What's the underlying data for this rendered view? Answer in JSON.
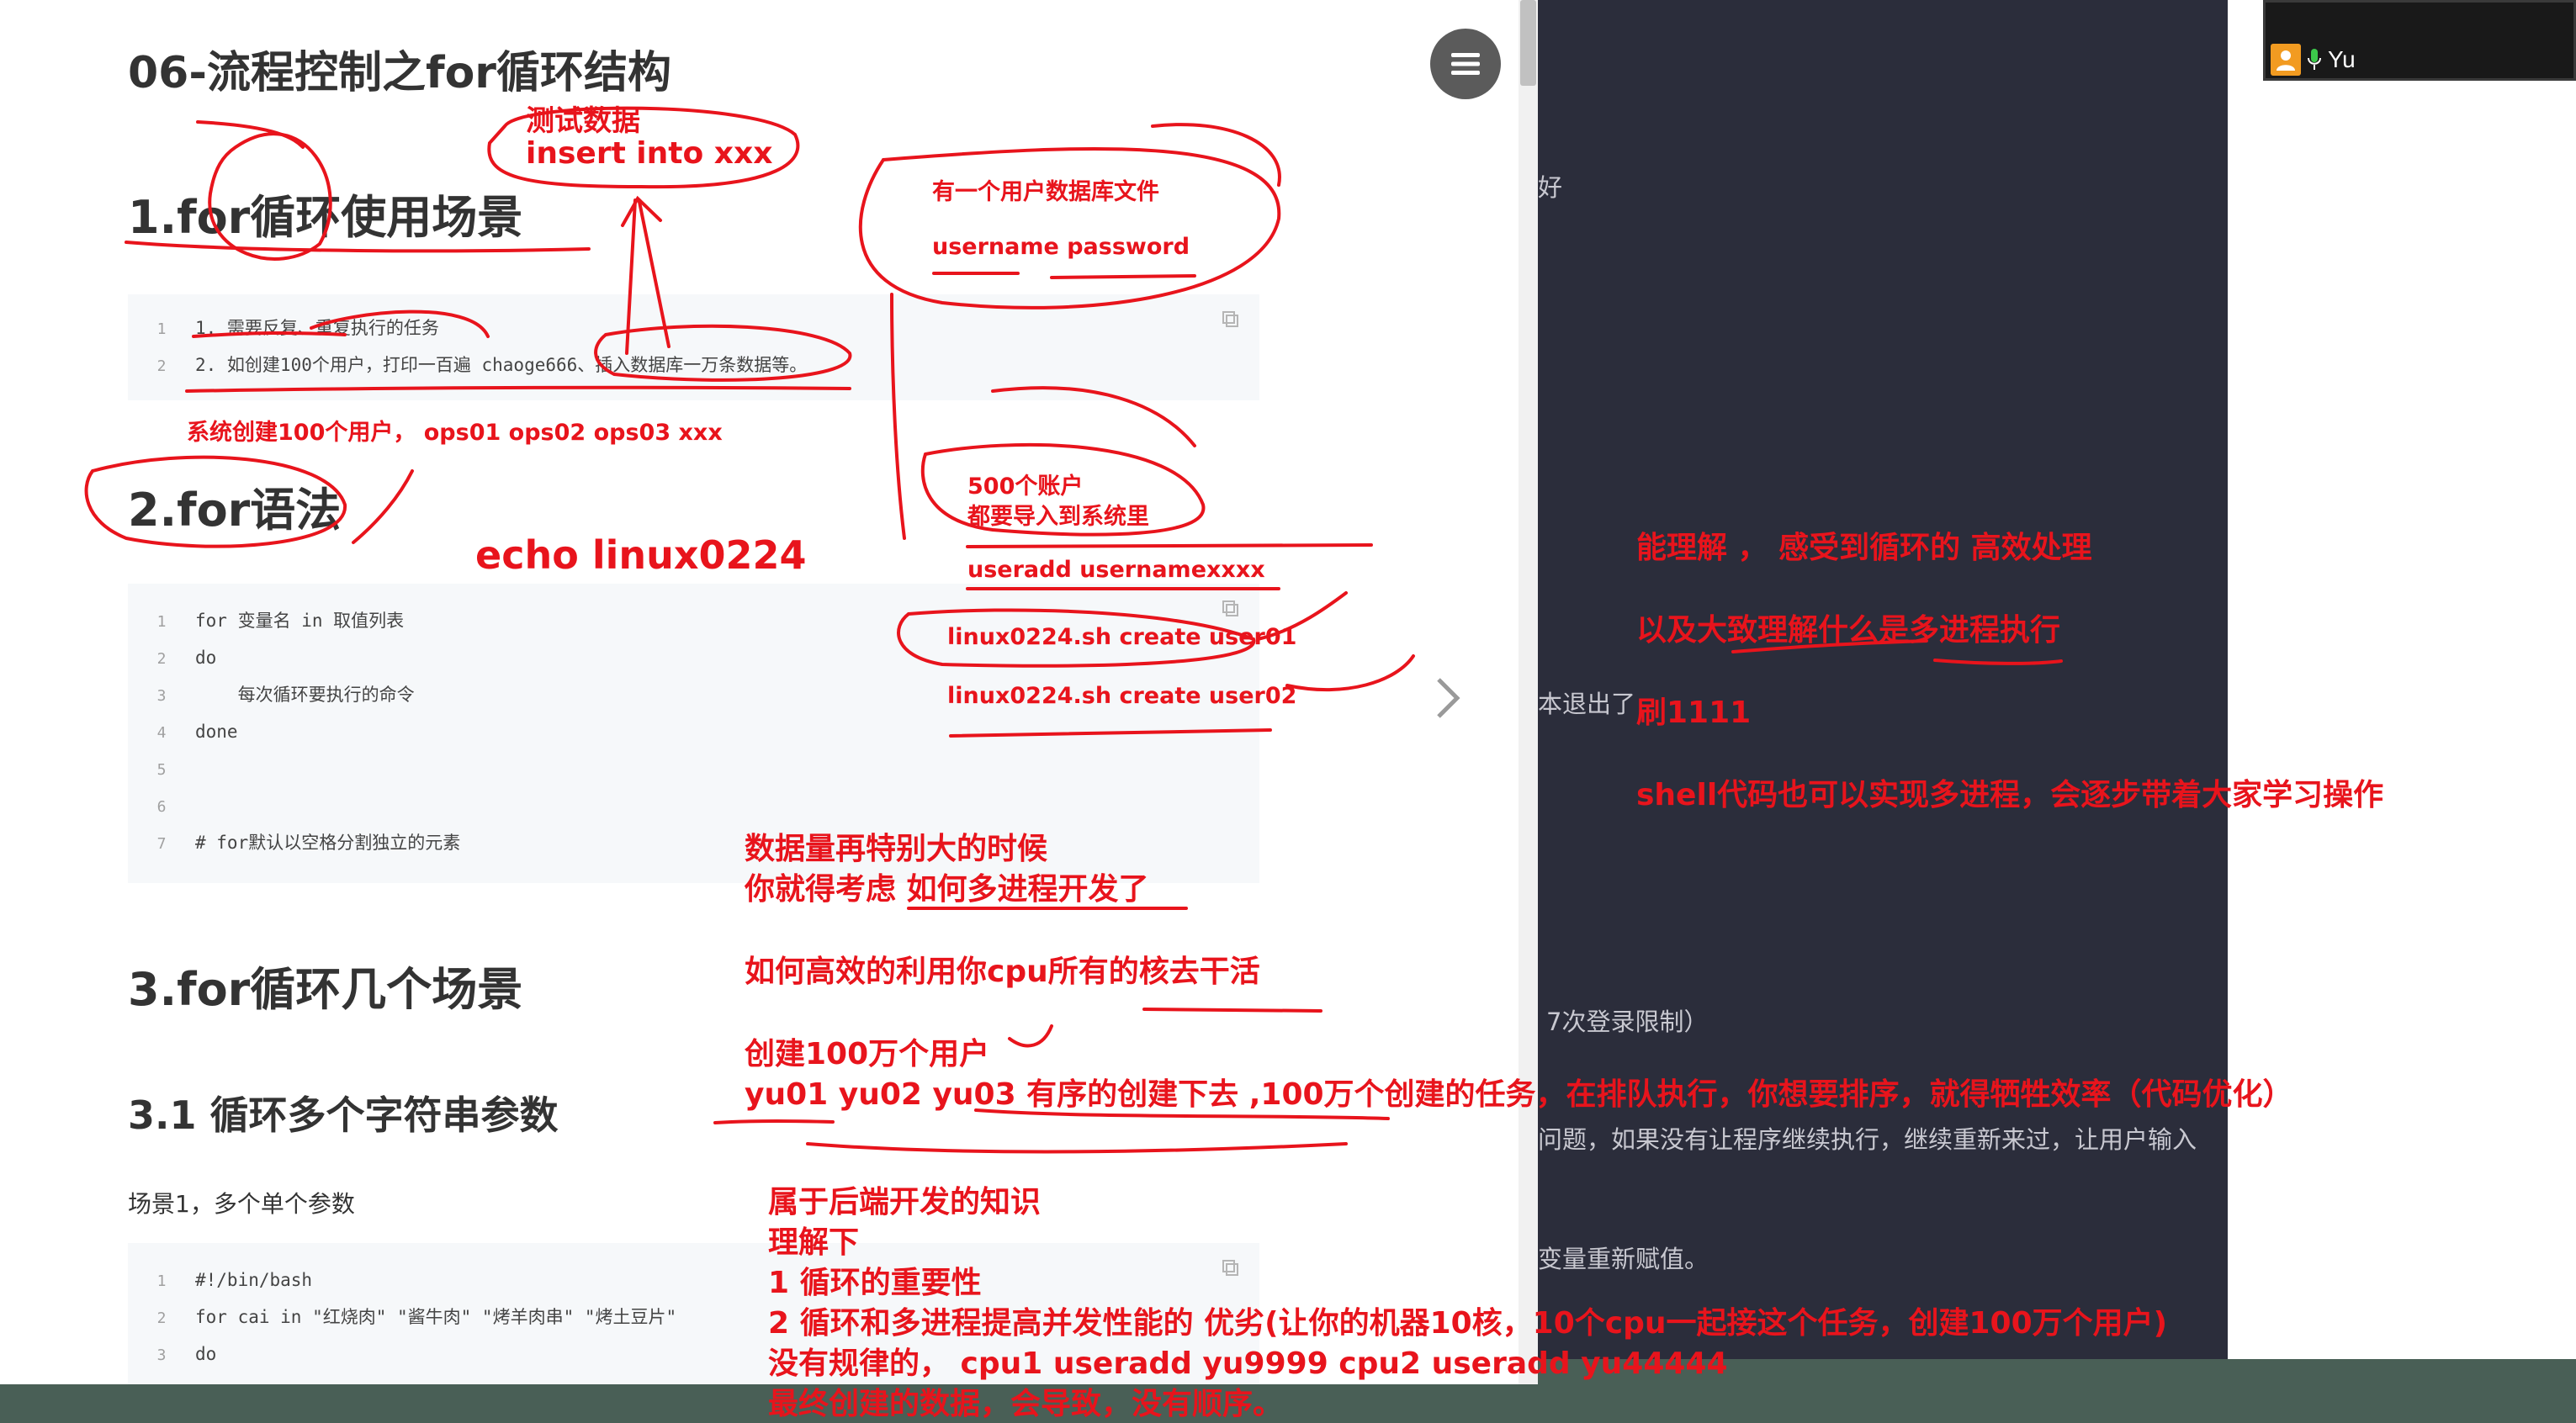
{
  "doc": {
    "title": "06-流程控制之for循环结构",
    "h_1": "1.for循环使用场景",
    "code1": [
      {
        "n": "1",
        "text": "1. 需要反复、重复执行的任务"
      },
      {
        "n": "2",
        "text": "2. 如创建100个用户，打印一百遍 chaoge666、插入数据库一万条数据等。"
      }
    ],
    "h_2": "2.for语法",
    "code2": [
      {
        "n": "1",
        "text": "for 变量名 in 取值列表"
      },
      {
        "n": "2",
        "text": "do"
      },
      {
        "n": "3",
        "text": "    每次循环要执行的命令"
      },
      {
        "n": "4",
        "text": "done"
      },
      {
        "n": "5",
        "text": ""
      },
      {
        "n": "6",
        "text": ""
      },
      {
        "n": "7",
        "text": "# for默认以空格分割独立的元素"
      }
    ],
    "h_3": "3.for循环几个场景",
    "h_3_1": "3.1 循环多个字符串参数",
    "scene1": "场景1，多个单个参数",
    "code3": [
      {
        "n": "1",
        "text": "#!/bin/bash"
      },
      {
        "n": "2",
        "text": "for cai in \"红烧肉\" \"酱牛肉\" \"烤羊肉串\" \"烤土豆片\""
      },
      {
        "n": "3",
        "text": "do"
      }
    ]
  },
  "icons": {
    "menu": "hamburger-menu-icon",
    "copy": "copy-icon",
    "next": "chevron-right-icon",
    "user": "user-icon",
    "mic": "microphone-icon"
  },
  "dark_panel": {
    "t1": "好",
    "t2": "本退出了",
    "t3": "7次登录限制）",
    "t4": "问题，如果没有让程序继续执行，继续重新来过，让用户输入",
    "t5": "变量重新赋值。"
  },
  "video": {
    "name": "Yu"
  },
  "annotations": {
    "test_data": "测试数据",
    "insert": "insert into xxx",
    "db_file": "有一个用户数据库文件",
    "user_pass": "username  password",
    "sys_create": "系统创建100个用户，  ops01  ops02    ops03 xxx",
    "accounts_500": "500个账户",
    "import_sys": "都要导入到系统里",
    "echo": "echo    linux0224",
    "useradd": "useradd  usernamexxxx",
    "create1": "linux0224.sh create  user01",
    "create2": "linux0224.sh create  user02",
    "big_data": "数据量再特别大的时候",
    "consider": "你就得考虑 如何多进程开发了",
    "cpu_cores": "如何高效的利用你cpu所有的核去干活",
    "million": "创建100万个用户",
    "ordered": "yu01 yu02 yu03   有序的创建下去 ,100万个创建的任务，在排队执行，你想要排序，就得牺牲效率（代码优化）",
    "backend": "属于后端开发的知识",
    "understand": "理解下",
    "point1": "1 循环的重要性",
    "point2": "2 循环和多进程提高并发性能的 优劣(让你的机器10核，10个cpu一起接这个任务，创建100万个用户)",
    "no_rule": "没有规律的，  cpu1   useradd   yu9999    cpu2   useradd   yu44444",
    "final": "最终创建的数据，会导致，没有顺序。",
    "r1": "能理解 ，  感受到循环的   高效处理",
    "r2": "以及大致理解什么是多进程执行",
    "r3": "刷1111",
    "r4": "shell代码也可以实现多进程，会逐步带着大家学习操作"
  },
  "colors": {
    "annotation": "#e8141c",
    "dark_panel": "#2b2d3b",
    "code_bg": "#f6f8fa",
    "taskbar": "#495f56"
  }
}
